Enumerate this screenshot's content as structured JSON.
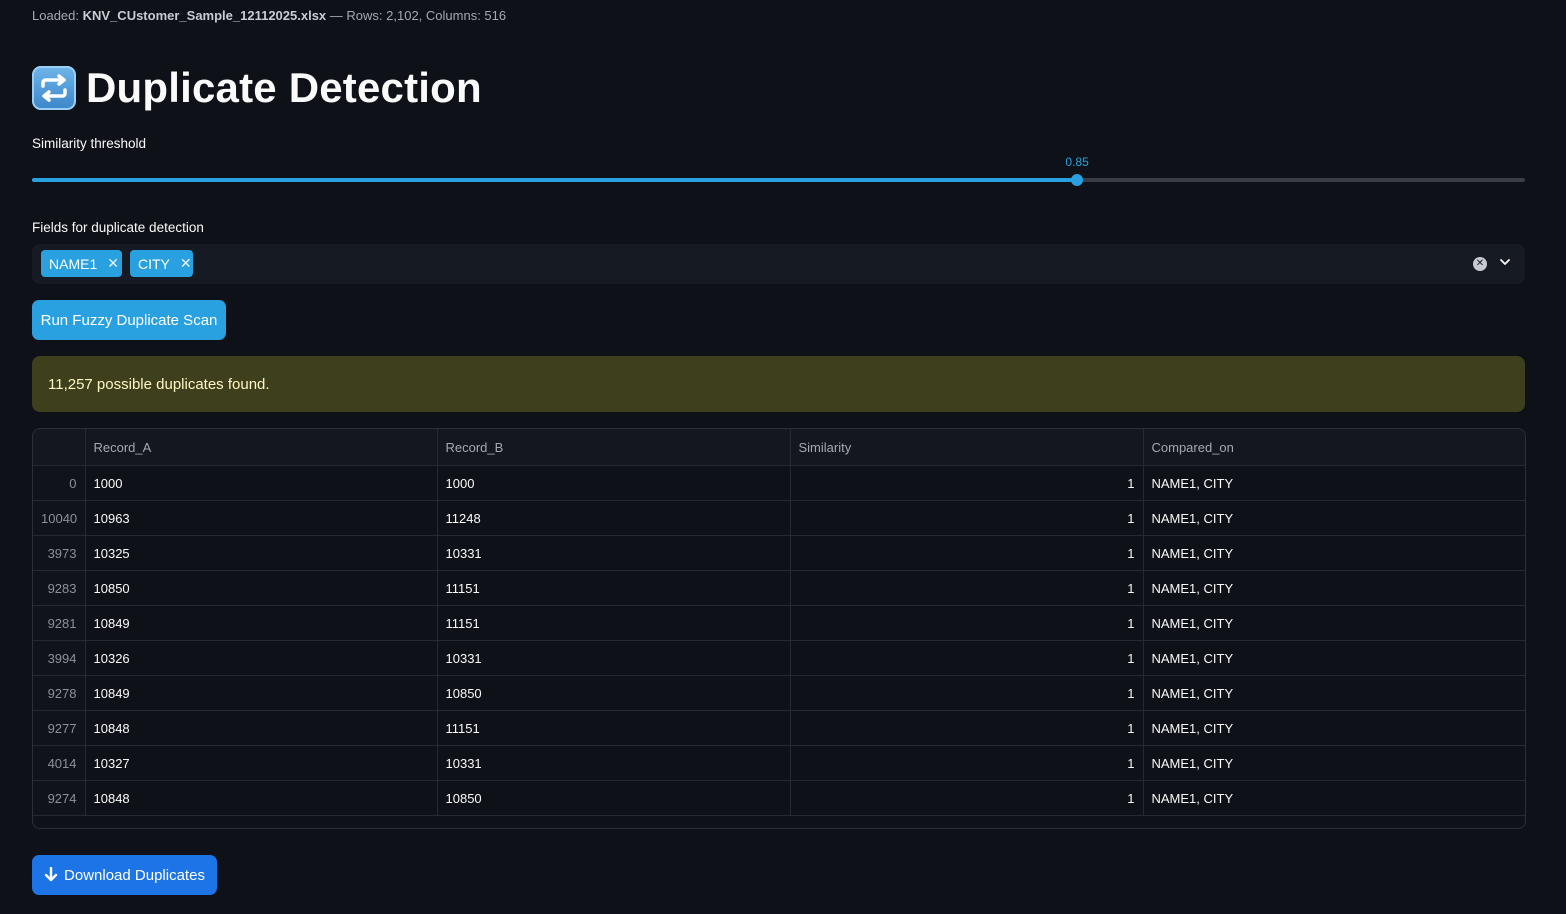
{
  "status": {
    "loaded_prefix": "Loaded:",
    "filename": "KNV_CUstomer_Sample_12112025.xlsx",
    "details": "— Rows: 2,102, Columns: 516"
  },
  "header": {
    "title": "Duplicate Detection",
    "icon": "repeat-arrows-icon"
  },
  "threshold": {
    "label": "Similarity threshold",
    "value": 0.85,
    "value_text": "0.85",
    "min": 0,
    "max": 1
  },
  "fields": {
    "label": "Fields for duplicate detection",
    "selected": [
      "NAME1",
      "CITY"
    ]
  },
  "run_button": {
    "label": "Run Fuzzy Duplicate Scan"
  },
  "result": {
    "message": "11,257 possible duplicates found."
  },
  "table": {
    "columns": [
      "",
      "Record_A",
      "Record_B",
      "Similarity",
      "Compared_on"
    ],
    "rows": [
      [
        "0",
        "1000",
        "1000",
        "1",
        "NAME1, CITY"
      ],
      [
        "10040",
        "10963",
        "11248",
        "1",
        "NAME1, CITY"
      ],
      [
        "3973",
        "10325",
        "10331",
        "1",
        "NAME1, CITY"
      ],
      [
        "9283",
        "10850",
        "11151",
        "1",
        "NAME1, CITY"
      ],
      [
        "9281",
        "10849",
        "11151",
        "1",
        "NAME1, CITY"
      ],
      [
        "3994",
        "10326",
        "10331",
        "1",
        "NAME1, CITY"
      ],
      [
        "9278",
        "10849",
        "10850",
        "1",
        "NAME1, CITY"
      ],
      [
        "9277",
        "10848",
        "11151",
        "1",
        "NAME1, CITY"
      ],
      [
        "4014",
        "10327",
        "10331",
        "1",
        "NAME1, CITY"
      ],
      [
        "9274",
        "10848",
        "10850",
        "1",
        "NAME1, CITY"
      ]
    ]
  },
  "download_button": {
    "label": "Download Duplicates",
    "icon": "download-arrow-icon"
  },
  "colors": {
    "background": "#0e1117",
    "accent": "#29a0e0",
    "download": "#1c74e6",
    "alert_bg": "#3e3f1c"
  }
}
